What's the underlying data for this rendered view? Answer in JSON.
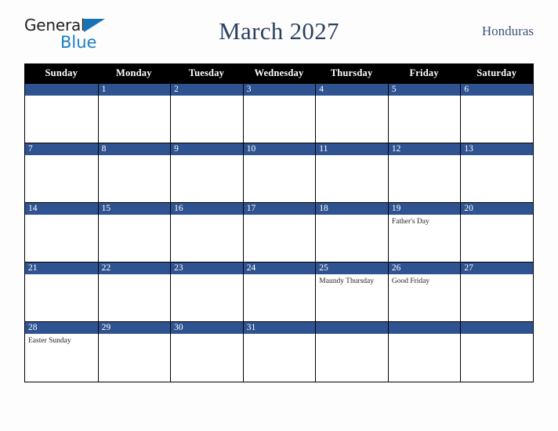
{
  "brand": {
    "name_part1": "General",
    "name_part2": "Blue",
    "triangle_icon": "triangle-icon",
    "color_dark": "#231f20",
    "color_blue": "#1a7fc4"
  },
  "header": {
    "title": "March 2027",
    "country": "Honduras",
    "title_color": "#2b4161"
  },
  "calendar": {
    "accent_color": "#2f5391",
    "header_bg": "#000000",
    "day_headers": [
      "Sunday",
      "Monday",
      "Tuesday",
      "Wednesday",
      "Thursday",
      "Friday",
      "Saturday"
    ],
    "weeks": [
      [
        {
          "date": "",
          "events": []
        },
        {
          "date": "1",
          "events": []
        },
        {
          "date": "2",
          "events": []
        },
        {
          "date": "3",
          "events": []
        },
        {
          "date": "4",
          "events": []
        },
        {
          "date": "5",
          "events": []
        },
        {
          "date": "6",
          "events": []
        }
      ],
      [
        {
          "date": "7",
          "events": []
        },
        {
          "date": "8",
          "events": []
        },
        {
          "date": "9",
          "events": []
        },
        {
          "date": "10",
          "events": []
        },
        {
          "date": "11",
          "events": []
        },
        {
          "date": "12",
          "events": []
        },
        {
          "date": "13",
          "events": []
        }
      ],
      [
        {
          "date": "14",
          "events": []
        },
        {
          "date": "15",
          "events": []
        },
        {
          "date": "16",
          "events": []
        },
        {
          "date": "17",
          "events": []
        },
        {
          "date": "18",
          "events": []
        },
        {
          "date": "19",
          "events": [
            "Father's Day"
          ]
        },
        {
          "date": "20",
          "events": []
        }
      ],
      [
        {
          "date": "21",
          "events": []
        },
        {
          "date": "22",
          "events": []
        },
        {
          "date": "23",
          "events": []
        },
        {
          "date": "24",
          "events": []
        },
        {
          "date": "25",
          "events": [
            "Maundy Thursday"
          ]
        },
        {
          "date": "26",
          "events": [
            "Good Friday"
          ]
        },
        {
          "date": "27",
          "events": []
        }
      ],
      [
        {
          "date": "28",
          "events": [
            "Easter Sunday"
          ]
        },
        {
          "date": "29",
          "events": []
        },
        {
          "date": "30",
          "events": []
        },
        {
          "date": "31",
          "events": []
        },
        {
          "date": "",
          "events": []
        },
        {
          "date": "",
          "events": []
        },
        {
          "date": "",
          "events": []
        }
      ]
    ]
  }
}
